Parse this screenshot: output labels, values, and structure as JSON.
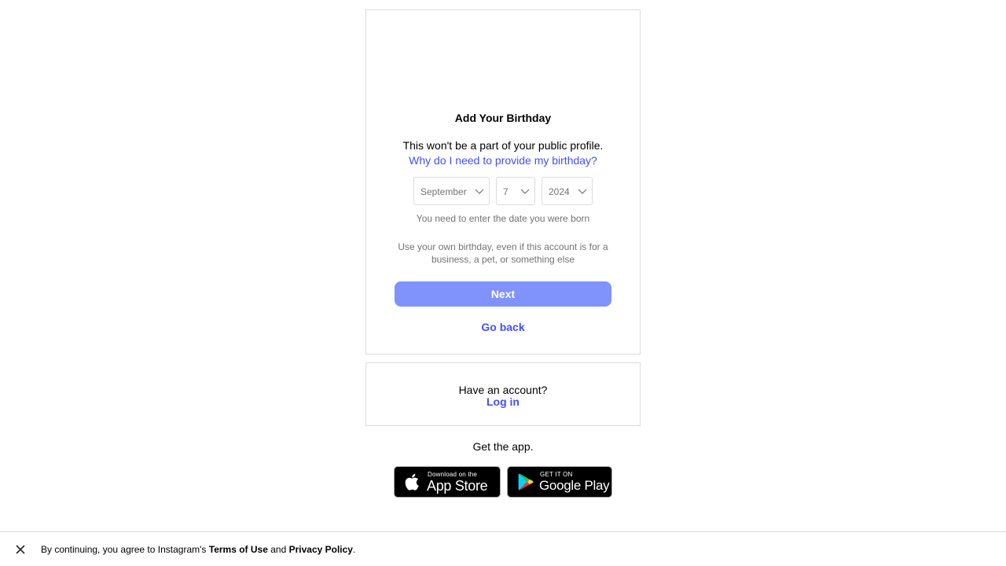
{
  "signup_card": {
    "illustration_icon": "birthday-cake-icon",
    "title": "Add Your Birthday",
    "subtitle": "This won't be a part of your public profile.",
    "why_link": "Why do I need to provide my birthday?",
    "month": {
      "selected": "September",
      "icon": "chevron-down-icon"
    },
    "day": {
      "selected": "7",
      "icon": "chevron-down-icon"
    },
    "year": {
      "selected": "2024",
      "icon": "chevron-down-icon"
    },
    "hint": "You need to enter the date you were born",
    "info": "Use your own birthday, even if this account is for a business, a pet, or something else",
    "next_button": "Next",
    "go_back": "Go back"
  },
  "login_card": {
    "prompt": "Have an account?",
    "login_link": "Log in"
  },
  "get_app": {
    "label": "Get the app.",
    "app_store": {
      "small": "Download on the",
      "big": "App Store",
      "icon": "apple-icon"
    },
    "google_play": {
      "small": "GET IT ON",
      "big": "Google Play",
      "icon": "google-play-icon"
    }
  },
  "footer": {
    "close_icon": "close-icon",
    "prefix": "By continuing, you agree to Instagram's ",
    "terms": "Terms of Use",
    "and": " and ",
    "privacy": "Privacy Policy",
    "suffix": "."
  },
  "colors": {
    "link": "#4150f7",
    "button": "#8092fb",
    "border": "#dbdbdb",
    "muted": "#737373"
  }
}
